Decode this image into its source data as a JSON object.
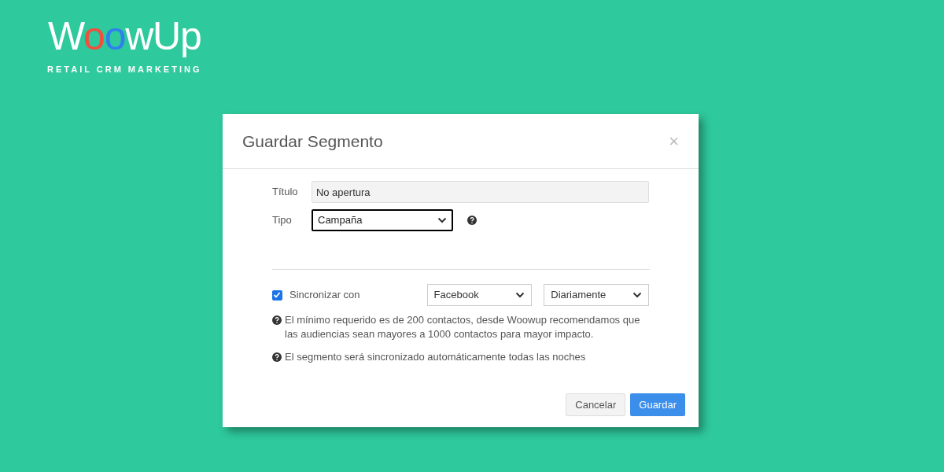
{
  "logo": {
    "text": "WoowUp",
    "tagline": "RETAIL CRM MARKETING"
  },
  "dialog": {
    "title": "Guardar Segmento",
    "close": "×",
    "fields": [
      {
        "kind": "text",
        "label": "Título",
        "value": "No apertura"
      },
      {
        "kind": "select",
        "label": "Tipo",
        "value": "Campaña",
        "focused": true,
        "help": true
      }
    ],
    "sync": {
      "label": "Sincronizar con",
      "checked": true,
      "network": "Facebook",
      "frequency": "Diariamente"
    },
    "notes": [
      "El mínimo requerido es de 200 contactos, desde Woowup recomendamos que las audiencias sean mayores a 1000 contactos para mayor impacto.",
      "El segmento será sincronizado automáticamente todas las noches"
    ],
    "buttons": [
      {
        "label": "Cancelar",
        "kind": "secondary"
      },
      {
        "label": "Guardar",
        "kind": "primary"
      }
    ]
  }
}
